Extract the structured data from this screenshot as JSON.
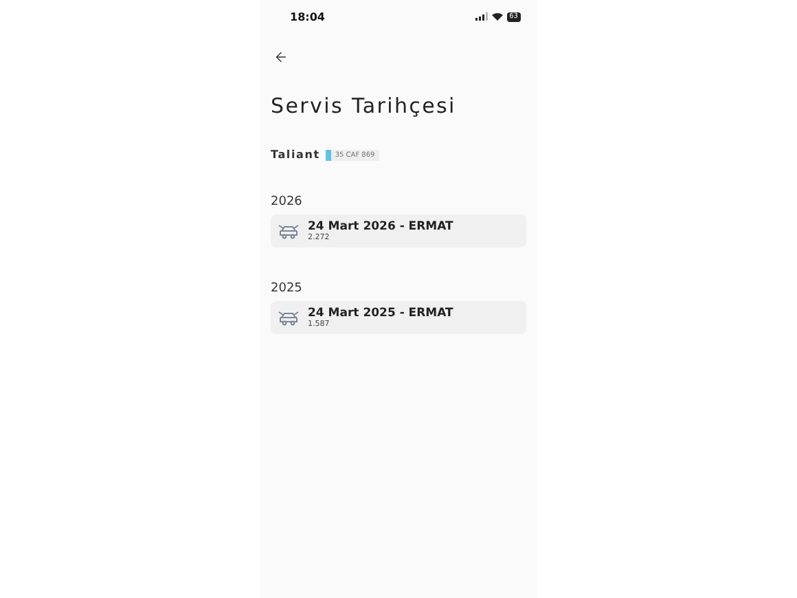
{
  "status_bar": {
    "time": "18:04",
    "battery": "63"
  },
  "title": "Servis Tarihçesi",
  "vehicle": {
    "model": "Taliant",
    "plate": "35 CAF 869"
  },
  "groups": [
    {
      "year": "2026",
      "records": [
        {
          "title": "24 Mart 2026 - ERMAT",
          "mileage": "2.272"
        }
      ]
    },
    {
      "year": "2025",
      "records": [
        {
          "title": "24 Mart 2025 - ERMAT",
          "mileage": "1.587"
        }
      ]
    }
  ]
}
